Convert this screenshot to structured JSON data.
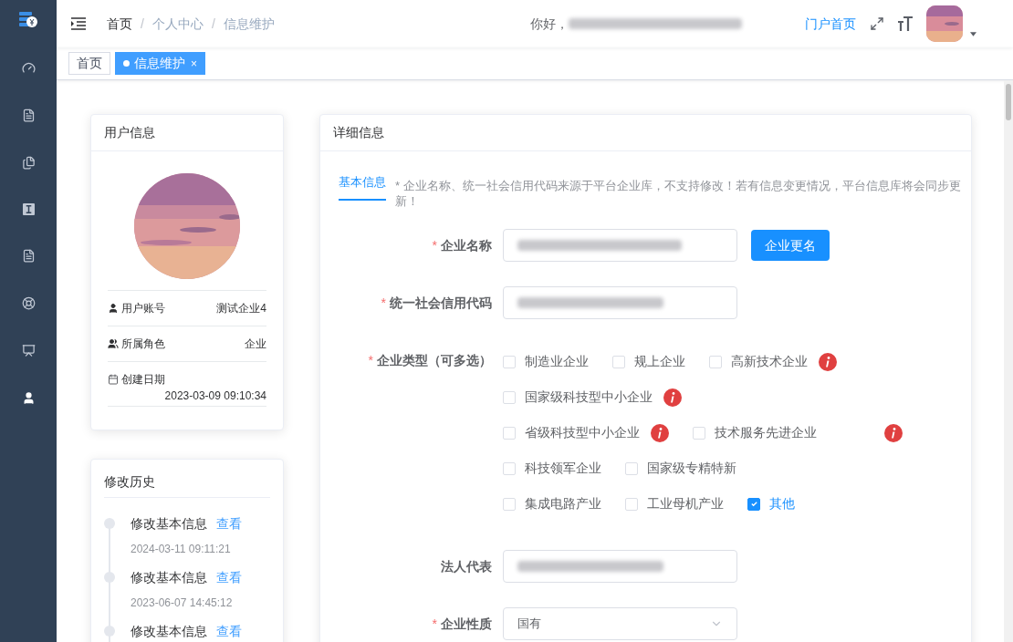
{
  "header": {
    "breadcrumb": [
      {
        "label": "首页",
        "current": false
      },
      {
        "label": "个人中心",
        "current": true
      },
      {
        "label": "信息维护",
        "current": true
      }
    ],
    "separator": "/",
    "greeting": "你好，",
    "portal_link": "门户首页"
  },
  "tags": [
    {
      "label": "首页",
      "selected": false
    },
    {
      "label": "信息维护",
      "selected": true,
      "close": "×"
    }
  ],
  "user_card": {
    "title": "用户信息",
    "rows": [
      {
        "kind": "user",
        "label": "用户账号",
        "value": "测试企业4"
      },
      {
        "kind": "role",
        "label": "所属角色",
        "value": "企业"
      },
      {
        "kind": "date",
        "label": "创建日期",
        "value": "2023-03-09 09:10:34"
      }
    ]
  },
  "history": {
    "title": "修改历史",
    "items": [
      {
        "title": "修改基本信息",
        "action": "查看",
        "time": "2024-03-11 09:11:21"
      },
      {
        "title": "修改基本信息",
        "action": "查看",
        "time": "2023-06-07 14:45:12"
      },
      {
        "title": "修改基本信息",
        "action": "查看"
      }
    ]
  },
  "details": {
    "title": "详细信息",
    "tab": {
      "label": "基本信息",
      "selected": true
    },
    "notice": "* 企业名称、统一社会信用代码来源于平台企业库，不支持修改！若有信息变更情况，平台信息库将会同步更新！",
    "required_mark": "*",
    "fields": [
      {
        "kind": "input",
        "label": "企业名称",
        "required": true,
        "button": "企业更名"
      },
      {
        "kind": "input",
        "label": "统一社会信用代码",
        "required": true
      },
      {
        "kind": "checkboxes",
        "label": "企业类型（可多选）",
        "required": true,
        "rows": [
          [
            {
              "label": "制造业企业",
              "checked": false,
              "info": false
            },
            {
              "label": "规上企业",
              "checked": false,
              "info": false
            },
            {
              "label": "高新技术企业",
              "checked": false,
              "info": true
            }
          ],
          [
            {
              "label": "国家级科技型中小企业",
              "checked": false,
              "info": true
            }
          ],
          [
            {
              "label": "省级科技型中小企业",
              "checked": false,
              "info": true
            },
            {
              "label": "技术服务先进企业",
              "checked": false,
              "info": true
            }
          ],
          [
            {
              "label": "科技领军企业",
              "checked": false,
              "info": false
            },
            {
              "label": "国家级专精特新",
              "checked": false,
              "info": false
            }
          ],
          [
            {
              "label": "集成电路产业",
              "checked": false,
              "info": false
            },
            {
              "label": "工业母机产业",
              "checked": false,
              "info": false
            },
            {
              "label": "其他",
              "checked": true,
              "info": false
            }
          ]
        ]
      },
      {
        "kind": "input",
        "label": "法人代表",
        "required": false
      },
      {
        "kind": "select",
        "label": "企业性质",
        "required": true,
        "value": "国有"
      }
    ]
  }
}
